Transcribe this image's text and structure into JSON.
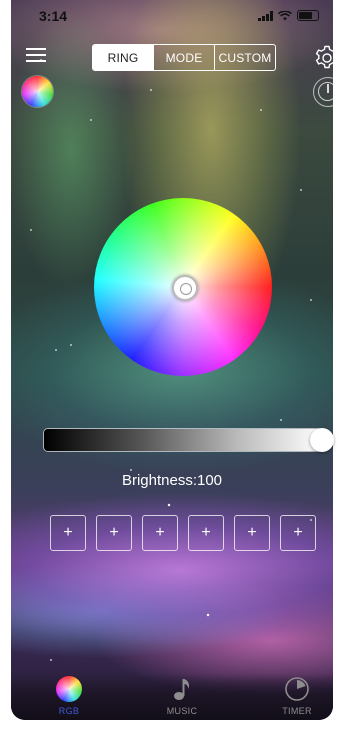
{
  "status_bar": {
    "time": "3:14"
  },
  "top_nav": {
    "tabs": [
      {
        "label": "RING",
        "active": true
      },
      {
        "label": "MODE",
        "active": false
      },
      {
        "label": "CUSTOM",
        "active": false
      }
    ]
  },
  "icons": {
    "menu": "hamburger-icon",
    "settings": "gear-icon",
    "power": "power-icon",
    "color_preview": "color-preview-icon"
  },
  "brightness": {
    "label": "Brightness:100",
    "value": 100,
    "max": 100
  },
  "presets": {
    "slots": [
      "+",
      "+",
      "+",
      "+",
      "+",
      "+"
    ]
  },
  "tab_bar": {
    "tabs": [
      {
        "label": "RGB",
        "icon": "rgb-color-icon",
        "active": true
      },
      {
        "label": "MUSIC",
        "icon": "music-note-icon",
        "active": false
      },
      {
        "label": "TIMER",
        "icon": "timer-icon",
        "active": false
      }
    ]
  },
  "colors": {
    "active_tab": "#3f5bd6",
    "inactive_tab": "#8d8d8d",
    "segment_active_bg": "#ffffff"
  }
}
